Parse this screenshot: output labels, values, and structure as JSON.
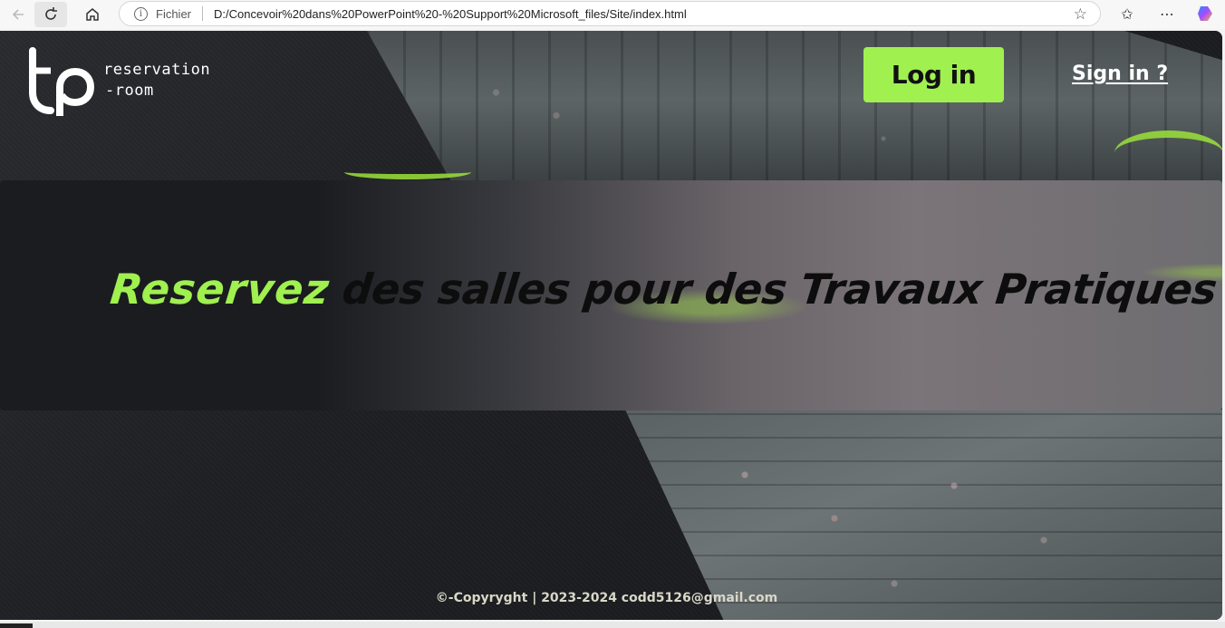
{
  "browser": {
    "scheme_label": "Fichier",
    "url": "D:/Concevoir%20dans%20PowerPoint%20-%20Support%20Microsoft_files/Site/index.html",
    "icons": [
      "back-arrow-icon",
      "reload-icon",
      "home-icon",
      "info-icon",
      "favorite-star-icon",
      "favorites-list-icon",
      "more-icon",
      "copilot-icon"
    ]
  },
  "header": {
    "logo_line1": "reservation",
    "logo_line2": "-room",
    "login_label": "Log in",
    "signin_label": "Sign in ?"
  },
  "hero": {
    "highlight": "Reservez",
    "rest": "des salles pour des Travaux Pratiques"
  },
  "footer": {
    "text": "©-Copyryght | 2023-2024 codd5126@gmail.com"
  },
  "colors": {
    "accent": "#a0f050",
    "background": "#1d1e22"
  }
}
